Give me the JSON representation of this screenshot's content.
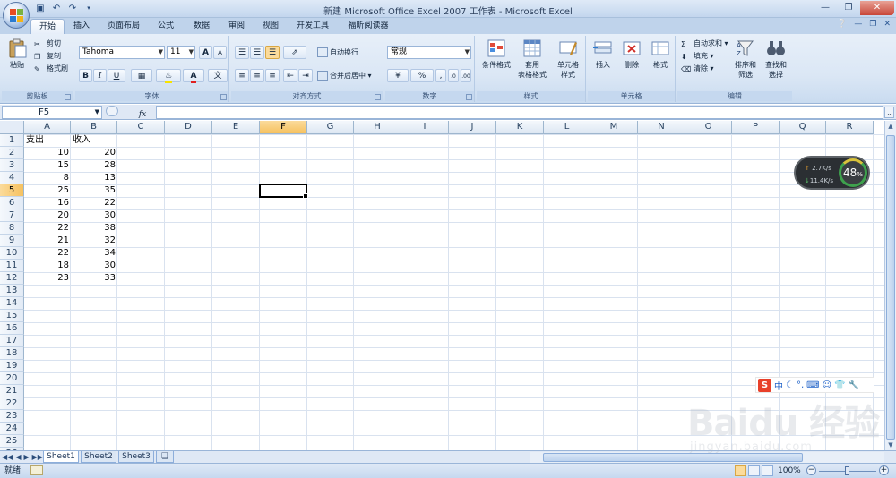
{
  "window": {
    "title": "新建 Microsoft Office Excel 2007 工作表 - Microsoft Excel"
  },
  "tabs": [
    "开始",
    "插入",
    "页面布局",
    "公式",
    "数据",
    "审阅",
    "视图",
    "开发工具",
    "福昕阅读器"
  ],
  "ribbon": {
    "clipboard": {
      "label": "剪贴板",
      "paste": "粘贴",
      "cut": "剪切",
      "copy": "复制",
      "format_painter": "格式刷"
    },
    "font": {
      "label": "字体",
      "font_name": "Tahoma",
      "font_size": "11",
      "bold": "B",
      "italic": "I",
      "underline": "U",
      "grow": "A",
      "shrink": "A"
    },
    "alignment": {
      "label": "对齐方式",
      "wrap_text": "自动换行",
      "merge_center": "合并后居中"
    },
    "number": {
      "label": "数字",
      "format": "常规",
      "percent": "%",
      "comma": ","
    },
    "styles": {
      "label": "样式",
      "conditional": "条件格式",
      "table_format_1": "套用",
      "table_format_2": "表格格式",
      "cell_styles_1": "单元格",
      "cell_styles_2": "样式"
    },
    "cells": {
      "label": "单元格",
      "insert": "插入",
      "delete": "删除",
      "format": "格式"
    },
    "editing": {
      "label": "编辑",
      "autosum": "自动求和",
      "fill": "填充",
      "clear": "清除",
      "sort_1": "排序和",
      "sort_2": "筛选",
      "find_1": "查找和",
      "find_2": "选择"
    }
  },
  "formula_bar": {
    "name_box": "F5",
    "fx": "fx",
    "formula": ""
  },
  "columns": [
    "A",
    "B",
    "C",
    "D",
    "E",
    "F",
    "G",
    "H",
    "I",
    "J",
    "K",
    "L",
    "M",
    "N",
    "O",
    "P",
    "Q",
    "R"
  ],
  "selected_column": "F",
  "rows": [
    "1",
    "2",
    "3",
    "4",
    "5",
    "6",
    "7",
    "8",
    "9",
    "10",
    "11",
    "12",
    "13",
    "14",
    "15",
    "16",
    "17",
    "18",
    "19",
    "20",
    "21",
    "22",
    "23",
    "24",
    "25",
    "26"
  ],
  "selected_row": "5",
  "sheet_data": {
    "header": [
      "支出",
      "收入"
    ],
    "values": [
      [
        "10",
        "20"
      ],
      [
        "15",
        "28"
      ],
      [
        "8",
        "13"
      ],
      [
        "25",
        "35"
      ],
      [
        "16",
        "22"
      ],
      [
        "20",
        "30"
      ],
      [
        "22",
        "38"
      ],
      [
        "21",
        "32"
      ],
      [
        "22",
        "34"
      ],
      [
        "18",
        "30"
      ],
      [
        "23",
        "33"
      ]
    ]
  },
  "sheet_tabs": [
    "Sheet1",
    "Sheet2",
    "Sheet3"
  ],
  "status": {
    "ready": "就绪",
    "zoom": "100%"
  },
  "net_widget": {
    "up": "2.7K/s",
    "down": "11.4K/s",
    "cpu": "48",
    "cpu_unit": "%"
  },
  "watermark": {
    "brand": "Baidu 经验",
    "url": "jingyan.baidu.com"
  },
  "ime": {
    "mode": "中"
  }
}
